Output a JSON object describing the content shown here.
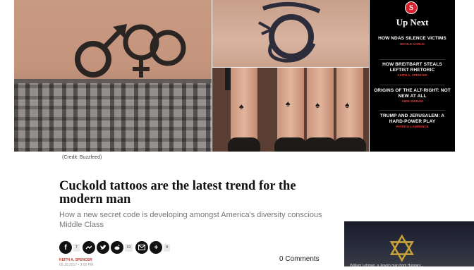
{
  "credit": "(Credit: Buzzfeed)",
  "upnext": {
    "logo": "S",
    "heading": "Up Next",
    "items": [
      {
        "title": "HOW NDAS SILENCE VICTIMS",
        "author": "NICOLE KARLIS"
      },
      {
        "title": "HOW BREITBART STEALS LEFTIST RHETORIC",
        "author": "KEITH A. SPENCER"
      },
      {
        "title": "ORIGINS OF THE ALT-RIGHT: NOT NEW AT ALL",
        "author": "AMIR SHIRAM"
      },
      {
        "title": "TRUMP AND JERUSALEM: A HARD-POWER PLAY",
        "author": "PATRICK LAWRENCE"
      }
    ]
  },
  "article": {
    "headline": "Cuckold tattoos are the latest trend for the modern man",
    "subhead": "How a new secret code is developing amongst America's diversity conscious Middle Class",
    "author": "KEITH A. SPENCER",
    "date": "09.10.2017 • 3:00 PM",
    "comments": "0 Comments"
  },
  "share": {
    "facebook_count": "7",
    "reddit_count": "63",
    "more_count": "8"
  },
  "icons": [
    "facebook-icon",
    "messenger-icon",
    "twitter-icon",
    "reddit-icon",
    "email-icon",
    "plus-icon"
  ],
  "thumb_caption": "William Lehman, a Jewish man from Hungary..."
}
